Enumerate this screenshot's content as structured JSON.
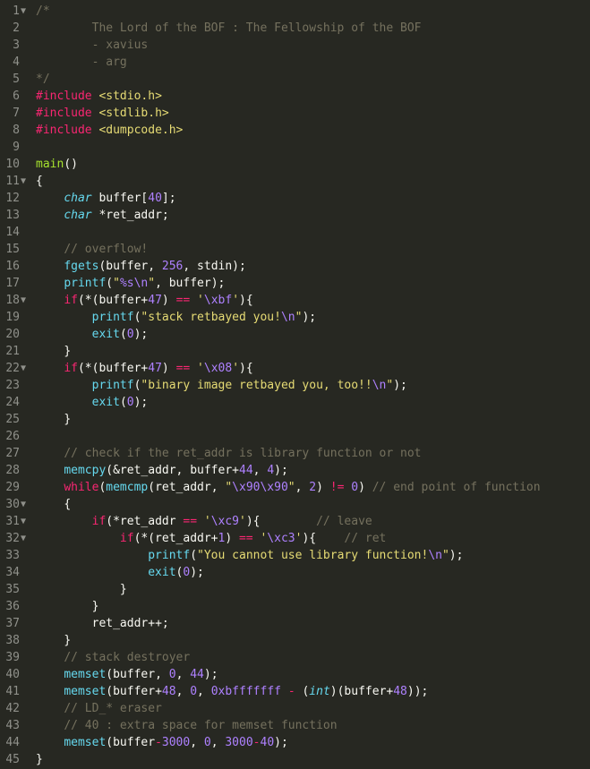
{
  "editor": {
    "colors": {
      "background": "#272822",
      "comment": "#75715e",
      "keyword": "#f92672",
      "type": "#66d9ef",
      "string": "#e6db74",
      "number": "#ae81ff",
      "function_name": "#a6e22e",
      "plain": "#f8f8f2",
      "gutter": "#8f908a"
    },
    "lines": [
      {
        "n": "1",
        "fold": true,
        "tokens": [
          [
            "comment",
            "/*"
          ]
        ]
      },
      {
        "n": "2",
        "fold": false,
        "tokens": [
          [
            "indent",
            "        "
          ],
          [
            "comment",
            "The Lord of the BOF : The Fellowship of the BOF"
          ]
        ]
      },
      {
        "n": "3",
        "fold": false,
        "tokens": [
          [
            "indent",
            "        "
          ],
          [
            "comment",
            "- xavius"
          ]
        ]
      },
      {
        "n": "4",
        "fold": false,
        "tokens": [
          [
            "indent",
            "        "
          ],
          [
            "comment",
            "- arg"
          ]
        ]
      },
      {
        "n": "5",
        "fold": false,
        "tokens": [
          [
            "comment",
            "*/"
          ]
        ]
      },
      {
        "n": "6",
        "fold": false,
        "tokens": [
          [
            "keyword",
            "#include"
          ],
          [
            "plain",
            " "
          ],
          [
            "string",
            "<stdio.h>"
          ]
        ]
      },
      {
        "n": "7",
        "fold": false,
        "tokens": [
          [
            "keyword",
            "#include"
          ],
          [
            "plain",
            " "
          ],
          [
            "string",
            "<stdlib.h>"
          ]
        ]
      },
      {
        "n": "8",
        "fold": false,
        "tokens": [
          [
            "keyword",
            "#include"
          ],
          [
            "plain",
            " "
          ],
          [
            "string",
            "<dumpcode.h>"
          ]
        ]
      },
      {
        "n": "9",
        "fold": false,
        "tokens": []
      },
      {
        "n": "10",
        "fold": false,
        "tokens": [
          [
            "fname",
            "main"
          ],
          [
            "plain",
            "()"
          ]
        ]
      },
      {
        "n": "11",
        "fold": true,
        "tokens": [
          [
            "plain",
            "{"
          ]
        ]
      },
      {
        "n": "12",
        "fold": false,
        "tokens": [
          [
            "indent",
            "    "
          ],
          [
            "type",
            "char"
          ],
          [
            "plain",
            " buffer["
          ],
          [
            "number",
            "40"
          ],
          [
            "plain",
            "];"
          ]
        ]
      },
      {
        "n": "13",
        "fold": false,
        "tokens": [
          [
            "indent",
            "    "
          ],
          [
            "type",
            "char"
          ],
          [
            "plain",
            " *ret_addr;"
          ]
        ]
      },
      {
        "n": "14",
        "fold": false,
        "tokens": []
      },
      {
        "n": "15",
        "fold": false,
        "tokens": [
          [
            "indent",
            "    "
          ],
          [
            "comment",
            "// overflow!"
          ]
        ]
      },
      {
        "n": "16",
        "fold": false,
        "tokens": [
          [
            "indent",
            "    "
          ],
          [
            "func",
            "fgets"
          ],
          [
            "plain",
            "(buffer, "
          ],
          [
            "number",
            "256"
          ],
          [
            "plain",
            ", stdin);"
          ]
        ]
      },
      {
        "n": "17",
        "fold": false,
        "tokens": [
          [
            "indent",
            "    "
          ],
          [
            "func",
            "printf"
          ],
          [
            "plain",
            "("
          ],
          [
            "string",
            "\""
          ],
          [
            "escape",
            "%s\\n"
          ],
          [
            "string",
            "\""
          ],
          [
            "plain",
            ", buffer);"
          ]
        ]
      },
      {
        "n": "18",
        "fold": true,
        "tokens": [
          [
            "indent",
            "    "
          ],
          [
            "keyword",
            "if"
          ],
          [
            "plain",
            "(*(buffer+"
          ],
          [
            "number",
            "47"
          ],
          [
            "plain",
            ") "
          ],
          [
            "keyword",
            "=="
          ],
          [
            "plain",
            " "
          ],
          [
            "string",
            "'"
          ],
          [
            "escape",
            "\\xbf"
          ],
          [
            "string",
            "'"
          ],
          [
            "plain",
            "){"
          ]
        ]
      },
      {
        "n": "19",
        "fold": false,
        "tokens": [
          [
            "indent",
            "        "
          ],
          [
            "func",
            "printf"
          ],
          [
            "plain",
            "("
          ],
          [
            "string",
            "\"stack retbayed you!"
          ],
          [
            "escape",
            "\\n"
          ],
          [
            "string",
            "\""
          ],
          [
            "plain",
            ");"
          ]
        ]
      },
      {
        "n": "20",
        "fold": false,
        "tokens": [
          [
            "indent",
            "        "
          ],
          [
            "func",
            "exit"
          ],
          [
            "plain",
            "("
          ],
          [
            "number",
            "0"
          ],
          [
            "plain",
            ");"
          ]
        ]
      },
      {
        "n": "21",
        "fold": false,
        "tokens": [
          [
            "indent",
            "    "
          ],
          [
            "plain",
            "}"
          ]
        ]
      },
      {
        "n": "22",
        "fold": true,
        "tokens": [
          [
            "indent",
            "    "
          ],
          [
            "keyword",
            "if"
          ],
          [
            "plain",
            "(*(buffer+"
          ],
          [
            "number",
            "47"
          ],
          [
            "plain",
            ") "
          ],
          [
            "keyword",
            "=="
          ],
          [
            "plain",
            " "
          ],
          [
            "string",
            "'"
          ],
          [
            "escape",
            "\\x08"
          ],
          [
            "string",
            "'"
          ],
          [
            "plain",
            "){"
          ]
        ]
      },
      {
        "n": "23",
        "fold": false,
        "tokens": [
          [
            "indent",
            "        "
          ],
          [
            "func",
            "printf"
          ],
          [
            "plain",
            "("
          ],
          [
            "string",
            "\"binary image retbayed you, too!!"
          ],
          [
            "escape",
            "\\n"
          ],
          [
            "string",
            "\""
          ],
          [
            "plain",
            ");"
          ]
        ]
      },
      {
        "n": "24",
        "fold": false,
        "tokens": [
          [
            "indent",
            "        "
          ],
          [
            "func",
            "exit"
          ],
          [
            "plain",
            "("
          ],
          [
            "number",
            "0"
          ],
          [
            "plain",
            ");"
          ]
        ]
      },
      {
        "n": "25",
        "fold": false,
        "tokens": [
          [
            "indent",
            "    "
          ],
          [
            "plain",
            "}"
          ]
        ]
      },
      {
        "n": "26",
        "fold": false,
        "tokens": []
      },
      {
        "n": "27",
        "fold": false,
        "tokens": [
          [
            "indent",
            "    "
          ],
          [
            "comment",
            "// check if the ret_addr is library function or not"
          ]
        ]
      },
      {
        "n": "28",
        "fold": false,
        "tokens": [
          [
            "indent",
            "    "
          ],
          [
            "func",
            "memcpy"
          ],
          [
            "plain",
            "(&ret_addr, buffer+"
          ],
          [
            "number",
            "44"
          ],
          [
            "plain",
            ", "
          ],
          [
            "number",
            "4"
          ],
          [
            "plain",
            ");"
          ]
        ]
      },
      {
        "n": "29",
        "fold": false,
        "tokens": [
          [
            "indent",
            "    "
          ],
          [
            "keyword",
            "while"
          ],
          [
            "plain",
            "("
          ],
          [
            "func",
            "memcmp"
          ],
          [
            "plain",
            "(ret_addr, "
          ],
          [
            "string",
            "\""
          ],
          [
            "escape",
            "\\x90\\x90"
          ],
          [
            "string",
            "\""
          ],
          [
            "plain",
            ", "
          ],
          [
            "number",
            "2"
          ],
          [
            "plain",
            ") "
          ],
          [
            "keyword",
            "!="
          ],
          [
            "plain",
            " "
          ],
          [
            "number",
            "0"
          ],
          [
            "plain",
            ") "
          ],
          [
            "comment",
            "// end point of function"
          ]
        ]
      },
      {
        "n": "30",
        "fold": true,
        "tokens": [
          [
            "indent",
            "    "
          ],
          [
            "plain",
            "{"
          ]
        ]
      },
      {
        "n": "31",
        "fold": true,
        "tokens": [
          [
            "indent",
            "        "
          ],
          [
            "keyword",
            "if"
          ],
          [
            "plain",
            "(*ret_addr "
          ],
          [
            "keyword",
            "=="
          ],
          [
            "plain",
            " "
          ],
          [
            "string",
            "'"
          ],
          [
            "escape",
            "\\xc9"
          ],
          [
            "string",
            "'"
          ],
          [
            "plain",
            "){"
          ],
          [
            "indent",
            "        "
          ],
          [
            "comment",
            "// leave"
          ]
        ]
      },
      {
        "n": "32",
        "fold": true,
        "tokens": [
          [
            "indent",
            "            "
          ],
          [
            "keyword",
            "if"
          ],
          [
            "plain",
            "(*(ret_addr+"
          ],
          [
            "number",
            "1"
          ],
          [
            "plain",
            ") "
          ],
          [
            "keyword",
            "=="
          ],
          [
            "plain",
            " "
          ],
          [
            "string",
            "'"
          ],
          [
            "escape",
            "\\xc3"
          ],
          [
            "string",
            "'"
          ],
          [
            "plain",
            "){"
          ],
          [
            "indent",
            "    "
          ],
          [
            "comment",
            "// ret"
          ]
        ]
      },
      {
        "n": "33",
        "fold": false,
        "tokens": [
          [
            "indent",
            "                "
          ],
          [
            "func",
            "printf"
          ],
          [
            "plain",
            "("
          ],
          [
            "string",
            "\"You cannot use library function!"
          ],
          [
            "escape",
            "\\n"
          ],
          [
            "string",
            "\""
          ],
          [
            "plain",
            ");"
          ]
        ]
      },
      {
        "n": "34",
        "fold": false,
        "tokens": [
          [
            "indent",
            "                "
          ],
          [
            "func",
            "exit"
          ],
          [
            "plain",
            "("
          ],
          [
            "number",
            "0"
          ],
          [
            "plain",
            ");"
          ]
        ]
      },
      {
        "n": "35",
        "fold": false,
        "tokens": [
          [
            "indent",
            "            "
          ],
          [
            "plain",
            "}"
          ]
        ]
      },
      {
        "n": "36",
        "fold": false,
        "tokens": [
          [
            "indent",
            "        "
          ],
          [
            "plain",
            "}"
          ]
        ]
      },
      {
        "n": "37",
        "fold": false,
        "tokens": [
          [
            "indent",
            "        "
          ],
          [
            "plain",
            "ret_addr++;"
          ]
        ]
      },
      {
        "n": "38",
        "fold": false,
        "tokens": [
          [
            "indent",
            "    "
          ],
          [
            "plain",
            "}"
          ]
        ]
      },
      {
        "n": "39",
        "fold": false,
        "tokens": [
          [
            "indent",
            "    "
          ],
          [
            "comment",
            "// stack destroyer"
          ]
        ]
      },
      {
        "n": "40",
        "fold": false,
        "tokens": [
          [
            "indent",
            "    "
          ],
          [
            "func",
            "memset"
          ],
          [
            "plain",
            "(buffer, "
          ],
          [
            "number",
            "0"
          ],
          [
            "plain",
            ", "
          ],
          [
            "number",
            "44"
          ],
          [
            "plain",
            ");"
          ]
        ]
      },
      {
        "n": "41",
        "fold": false,
        "tokens": [
          [
            "indent",
            "    "
          ],
          [
            "func",
            "memset"
          ],
          [
            "plain",
            "(buffer+"
          ],
          [
            "number",
            "48"
          ],
          [
            "plain",
            ", "
          ],
          [
            "number",
            "0"
          ],
          [
            "plain",
            ", "
          ],
          [
            "number",
            "0xbfffffff"
          ],
          [
            "plain",
            " "
          ],
          [
            "keyword",
            "-"
          ],
          [
            "plain",
            " ("
          ],
          [
            "type",
            "int"
          ],
          [
            "plain",
            ")(buffer+"
          ],
          [
            "number",
            "48"
          ],
          [
            "plain",
            "));"
          ]
        ]
      },
      {
        "n": "42",
        "fold": false,
        "tokens": [
          [
            "indent",
            "    "
          ],
          [
            "comment",
            "// LD_* eraser"
          ]
        ]
      },
      {
        "n": "43",
        "fold": false,
        "tokens": [
          [
            "indent",
            "    "
          ],
          [
            "comment",
            "// 40 : extra space for memset function"
          ]
        ]
      },
      {
        "n": "44",
        "fold": false,
        "tokens": [
          [
            "indent",
            "    "
          ],
          [
            "func",
            "memset"
          ],
          [
            "plain",
            "(buffer"
          ],
          [
            "keyword",
            "-"
          ],
          [
            "number",
            "3000"
          ],
          [
            "plain",
            ", "
          ],
          [
            "number",
            "0"
          ],
          [
            "plain",
            ", "
          ],
          [
            "number",
            "3000"
          ],
          [
            "keyword",
            "-"
          ],
          [
            "number",
            "40"
          ],
          [
            "plain",
            ");"
          ]
        ]
      },
      {
        "n": "45",
        "fold": false,
        "tokens": [
          [
            "plain",
            "}"
          ]
        ]
      }
    ]
  }
}
